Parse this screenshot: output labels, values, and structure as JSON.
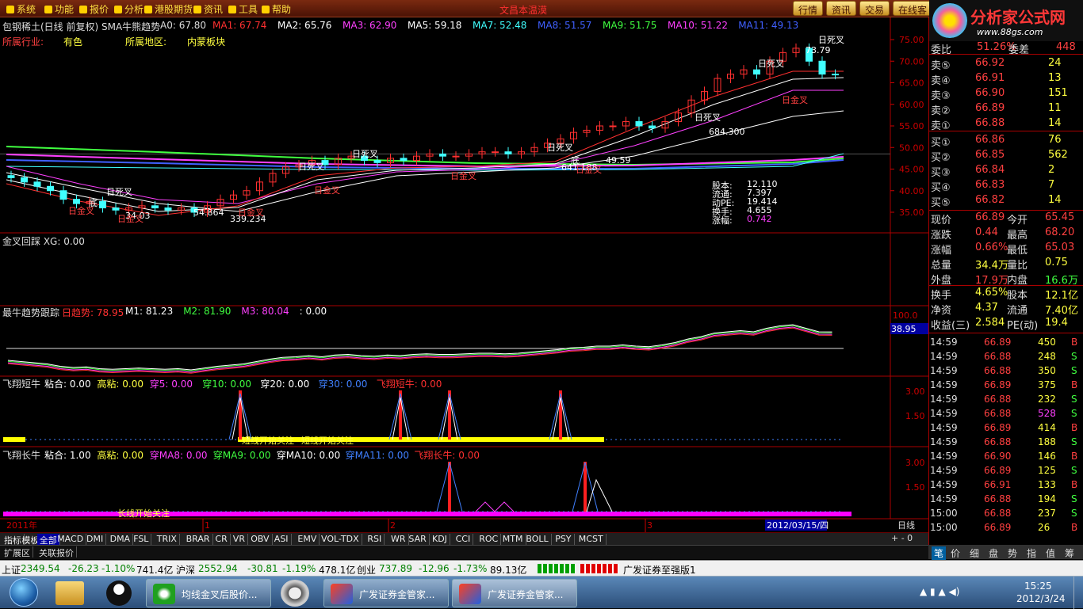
{
  "menu": [
    "系统",
    "功能",
    "报价",
    "分析",
    "港股期货",
    "资讯",
    "工具",
    "帮助"
  ],
  "app_title": "文昌本温漠",
  "right_tabs": [
    "行情",
    "资讯",
    "交易",
    "在线客"
  ],
  "logo": {
    "text": "分析家公式网",
    "url": "www.88gs.com"
  },
  "main_chart": {
    "title": "包钢稀土(日线 前复权) SMA牛熊趋势",
    "a0": "A0: 67.80",
    "ma_items": [
      {
        "label": "MA1: 67.74",
        "color": "#ff3030"
      },
      {
        "label": "MA2: 65.76",
        "color": "#ffffff"
      },
      {
        "label": "MA3: 62.90",
        "color": "#ff40ff"
      },
      {
        "label": "MA5: 59.18",
        "color": "#ffffff"
      },
      {
        "label": "MA7: 52.48",
        "color": "#40ffff"
      },
      {
        "label": "MA8: 51.57",
        "color": "#4060ff"
      },
      {
        "label": "MA9: 51.75",
        "color": "#40ff40"
      },
      {
        "label": "MA10: 51.22",
        "color": "#ff40ff"
      },
      {
        "label": "MA11: 49.13",
        "color": "#4060ff"
      }
    ],
    "info": [
      {
        "k": "所属行业:",
        "v": "有色"
      },
      {
        "k": "所属地区:",
        "v": "内蒙板块"
      }
    ],
    "stats": [
      {
        "k": "股本:",
        "v": "12.110"
      },
      {
        "k": "流通:",
        "v": "7.397"
      },
      {
        "k": "动PE:",
        "v": "19.414"
      },
      {
        "k": "换手:",
        "v": "4.655"
      },
      {
        "k": "涨幅:",
        "v": "0.742"
      }
    ],
    "price_annotations": [
      "73.79",
      "684.300",
      "641.188",
      "339.234",
      "54.864",
      "34.03",
      "49.59"
    ],
    "signal_labels": [
      "日死叉",
      "日金叉",
      "底"
    ],
    "y_ticks": [
      "75.00",
      "70.00",
      "65.00",
      "60.00",
      "55.00",
      "50.00",
      "45.00",
      "40.00",
      "35.00"
    ]
  },
  "panel2": {
    "title": "金叉回踩 XG: 0.00"
  },
  "panel3": {
    "title": "最牛趋势跟踪",
    "items": [
      {
        "label": "日趋势: 78.95",
        "color": "#ff3030"
      },
      {
        "label": "M1: 81.23",
        "color": "#ffffff"
      },
      {
        "label": "M2: 81.90",
        "color": "#40ff40"
      },
      {
        "label": "M3: 80.04",
        "color": "#ff40ff"
      },
      {
        "label": ": 0.00",
        "color": "#ffffff"
      }
    ],
    "y_ticks": [
      "100.0",
      "38.95"
    ]
  },
  "panel4": {
    "title": "飞翔短牛",
    "items": [
      {
        "label": "粘合: 0.00",
        "color": "#ffffff"
      },
      {
        "label": "高粘: 0.00",
        "color": "#ffff40"
      },
      {
        "label": "穿5: 0.00",
        "color": "#ff40ff"
      },
      {
        "label": "穿10: 0.00",
        "color": "#40ff40"
      },
      {
        "label": "穿20: 0.00",
        "color": "#ffffff"
      },
      {
        "label": "穿30: 0.00",
        "color": "#4080ff"
      },
      {
        "label": "飞翔短牛: 0.00",
        "color": "#ff3030"
      }
    ],
    "notes": [
      "短线开始关注",
      "短线开始关注"
    ],
    "y_ticks": [
      "3.00",
      "1.50"
    ]
  },
  "panel5": {
    "title": "飞翔长牛",
    "items": [
      {
        "label": "粘合: 1.00",
        "color": "#ffffff"
      },
      {
        "label": "高粘: 0.00",
        "color": "#ffff40"
      },
      {
        "label": "穿MA8: 0.00",
        "color": "#ff40ff"
      },
      {
        "label": "穿MA9: 0.00",
        "color": "#40ff40"
      },
      {
        "label": "穿MA10: 0.00",
        "color": "#ffffff"
      },
      {
        "label": "穿MA11: 0.00",
        "color": "#4080ff"
      },
      {
        "label": "飞翔长牛: 0.00",
        "color": "#ff3030"
      }
    ],
    "notes": [
      "长线开始关注"
    ],
    "y_ticks": [
      "3.00",
      "1.50"
    ]
  },
  "time_axis": {
    "labels": [
      "2011年",
      "1",
      "2",
      "3"
    ],
    "cursor": "2012/03/15/四",
    "period": "日线"
  },
  "bottom_tabs": [
    "指标",
    "模板",
    "全部",
    "MACD",
    "DMI",
    "DMA",
    "FSL",
    "TRIX",
    "BRAR",
    "CR",
    "VR",
    "OBV",
    "ASI",
    "EMV",
    "VOL-TDX",
    "RSI",
    "WR",
    "SAR",
    "KDJ",
    "CCI",
    "ROC",
    "MTM",
    "BOLL",
    "PSY",
    "MCST"
  ],
  "extra_tabs": [
    "扩展区",
    "关联报价"
  ],
  "quote": {
    "top": [
      {
        "k": "委比",
        "v": "51.26%",
        "k2": "委差",
        "v2": "448"
      }
    ],
    "sell": [
      {
        "k": "卖⑤",
        "p": "66.92",
        "v": "24"
      },
      {
        "k": "卖④",
        "p": "66.91",
        "v": "13"
      },
      {
        "k": "卖③",
        "p": "66.90",
        "v": "151"
      },
      {
        "k": "卖②",
        "p": "66.89",
        "v": "11"
      },
      {
        "k": "卖①",
        "p": "66.88",
        "v": "14"
      }
    ],
    "buy": [
      {
        "k": "买①",
        "p": "66.86",
        "v": "76"
      },
      {
        "k": "买②",
        "p": "66.85",
        "v": "562"
      },
      {
        "k": "买③",
        "p": "66.84",
        "v": "2"
      },
      {
        "k": "买④",
        "p": "66.83",
        "v": "7"
      },
      {
        "k": "买⑤",
        "p": "66.82",
        "v": "14"
      }
    ],
    "fields": [
      {
        "k": "现价",
        "v": "66.89",
        "k2": "今开",
        "v2": "65.45"
      },
      {
        "k": "涨跌",
        "v": "0.44",
        "k2": "最高",
        "v2": "68.20"
      },
      {
        "k": "涨幅",
        "v": "0.66%",
        "k2": "最低",
        "v2": "65.03"
      },
      {
        "k": "总量",
        "v": "34.4万",
        "k2": "量比",
        "v2": "0.75"
      },
      {
        "k": "外盘",
        "v": "17.9万",
        "k2": "内盘",
        "v2": "16.6万"
      },
      {
        "k": "换手",
        "v": "4.65%",
        "k2": "股本",
        "v2": "12.1亿"
      },
      {
        "k": "净资",
        "v": "4.37",
        "k2": "流通",
        "v2": "7.40亿"
      },
      {
        "k": "收益(三)",
        "v": "2.584",
        "k2": "PE(动)",
        "v2": "19.4"
      }
    ]
  },
  "ticks": [
    {
      "t": "14:59",
      "p": "66.89",
      "v": "450",
      "s": "B"
    },
    {
      "t": "14:59",
      "p": "66.88",
      "v": "248",
      "s": "S"
    },
    {
      "t": "14:59",
      "p": "66.88",
      "v": "350",
      "s": "S"
    },
    {
      "t": "14:59",
      "p": "66.89",
      "v": "375",
      "s": "B"
    },
    {
      "t": "14:59",
      "p": "66.88",
      "v": "232",
      "s": "S"
    },
    {
      "t": "14:59",
      "p": "66.88",
      "v": "528",
      "s": "S"
    },
    {
      "t": "14:59",
      "p": "66.89",
      "v": "414",
      "s": "B"
    },
    {
      "t": "14:59",
      "p": "66.88",
      "v": "188",
      "s": "S"
    },
    {
      "t": "14:59",
      "p": "66.90",
      "v": "146",
      "s": "B"
    },
    {
      "t": "14:59",
      "p": "66.89",
      "v": "125",
      "s": "S"
    },
    {
      "t": "14:59",
      "p": "66.91",
      "v": "133",
      "s": "B"
    },
    {
      "t": "14:59",
      "p": "66.88",
      "v": "194",
      "s": "S"
    },
    {
      "t": "15:00",
      "p": "66.88",
      "v": "237",
      "s": "S"
    },
    {
      "t": "15:00",
      "p": "66.89",
      "v": "26",
      "s": "B"
    }
  ],
  "right_bottom_tabs": [
    "笔",
    "价",
    "细",
    "盘",
    "势",
    "指",
    "值",
    "筹"
  ],
  "status": {
    "sh": {
      "name": "上证",
      "v": "2349.54",
      "c": "-26.23",
      "pct": "-1.10%",
      "amt": "741.4亿"
    },
    "sz": {
      "name": "沪深",
      "v": "2552.94",
      "c": "-30.81",
      "pct": "-1.19%",
      "amt": "478.1亿"
    },
    "cy": {
      "name": "创业",
      "v": "737.89",
      "c": "-12.96",
      "pct": "-1.73%",
      "amt": "89.13亿"
    },
    "broker": "广发证券至强版1"
  },
  "taskbar": {
    "tasks": [
      "均线金叉后股价...",
      "广发证券金管家...",
      "广发证券金管家..."
    ],
    "time": "15:25",
    "date": "2012/3/24"
  }
}
